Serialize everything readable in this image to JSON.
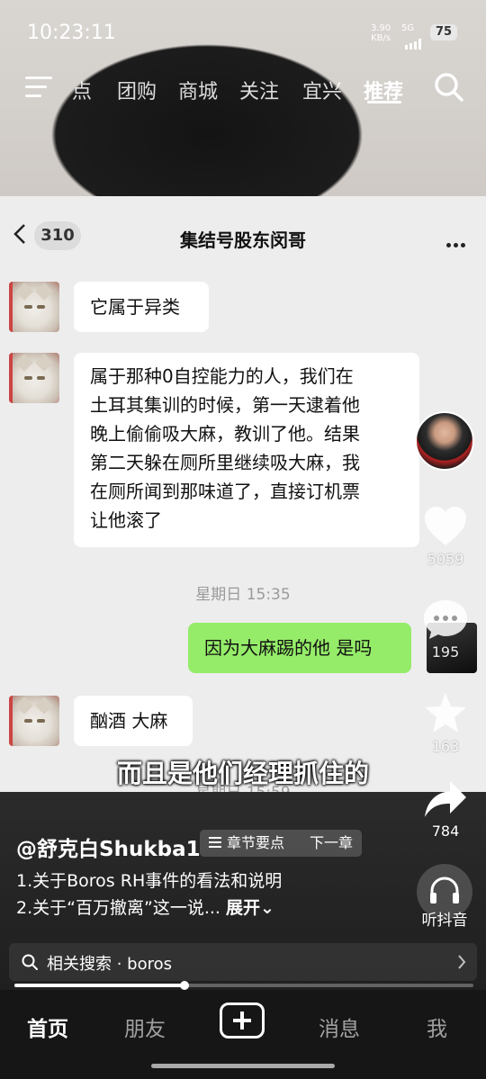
{
  "status_bar": {
    "time": "10:23:11",
    "net_speed": "3.90",
    "net_unit": "KB/s",
    "signal": "5G",
    "battery": "75"
  },
  "top_nav": {
    "tabs": [
      "点",
      "团购",
      "商城",
      "关注",
      "宜兴",
      "推荐"
    ],
    "active_tab": "推荐"
  },
  "chat": {
    "unread_count": "310",
    "title": "集结号股东闵哥",
    "messages": [
      {
        "from": "other",
        "text": "它属于异类"
      },
      {
        "from": "other",
        "lines": [
          "属于那种0自控能力的人，我们在",
          "土耳其集训的时候，第一天逮着他",
          "晚上偷偷吸大麻，教训了他。结果",
          "第二天躲在厕所里继续吸大麻，我",
          "在厕所闻到那味道了，直接订机票",
          "让他滚了"
        ]
      },
      {
        "type": "time",
        "text": "星期日 15:35"
      },
      {
        "from": "self",
        "text": "因为大麻踢的他 是吗"
      },
      {
        "from": "other",
        "text": "酗酒 大麻"
      },
      {
        "type": "time",
        "text": "星期日 15:59"
      }
    ]
  },
  "subtitle": "而且是他们经理抓住的",
  "video_info": {
    "author": "@舒克白Shukba1",
    "chapter_label": "章节要点",
    "next_label": "下一章",
    "desc_line1": "1.关于Boros RH事件的看法和说明",
    "desc_line2": "2.关于“百万撤离”这一说...",
    "expand_label": "展开",
    "related_search": "相关搜索 · boros",
    "progress_fraction": 0.37
  },
  "right_rail": {
    "likes": "5059",
    "comments": "195",
    "favorites": "163",
    "shares": "784",
    "listen_label": "听抖音"
  },
  "bottom_tabs": {
    "home": "首页",
    "friends": "朋友",
    "messages": "消息",
    "me": "我"
  }
}
